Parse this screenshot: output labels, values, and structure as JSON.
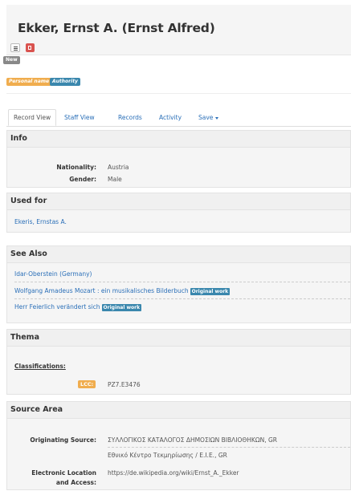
{
  "record": {
    "title": "Ekker, Ernst A. (Ernst Alfred)",
    "new_badge": "New",
    "tags": [
      "Personal name",
      "Authority"
    ]
  },
  "tabs": [
    "Record View",
    "Staff View",
    "Records",
    "Activity",
    "Save"
  ],
  "info": {
    "heading": "Info",
    "rows": [
      {
        "label": "Nationality:",
        "value": "Austria"
      },
      {
        "label": "Gender:",
        "value": "Male"
      }
    ]
  },
  "used_for": {
    "heading": "Used for",
    "items": [
      "Ekeris, Ernstas A."
    ]
  },
  "see_also": {
    "heading": "See Also",
    "items": [
      {
        "text": "Idar-Oberstein (Germany)",
        "badge": ""
      },
      {
        "text": "Wolfgang Amadeus Mozart : ein musikalisches Bilderbuch",
        "badge": "Original work"
      },
      {
        "text": "Herr Feierlich verändert sich",
        "badge": "Original work"
      }
    ]
  },
  "thema": {
    "heading": "Thema",
    "subheading": "Classifications:",
    "code_label": "LCC:",
    "code_value": "PZ7.E3476"
  },
  "source_area": {
    "heading": "Source Area",
    "originating_label": "Originating Source:",
    "originating_values": [
      "ΣΥΛΛΟΓΙΚΟΣ ΚΑΤΑΛΟΓΟΣ ΔΗΜΟΣΙΩΝ ΒΙΒΛΙΟΘΗΚΩΝ, GR",
      "Εθνικό Κέντρο Τεκμηρίωσης / Ε.Ι.Ε., GR"
    ],
    "electronic_label_line1": "Electronic Location",
    "electronic_label_line2": "and Access:",
    "electronic_value": "https://de.wikipedia.org/wiki/Ernst_A._Ekker"
  },
  "colors": {
    "link": "#2a6fb8",
    "personal_name_tag": "#f0ad4e",
    "authority_tag": "#3a87ad",
    "pdf_button": "#d9534f"
  },
  "icons": [
    "list-icon",
    "pdf-icon",
    "caret-down-icon"
  ]
}
